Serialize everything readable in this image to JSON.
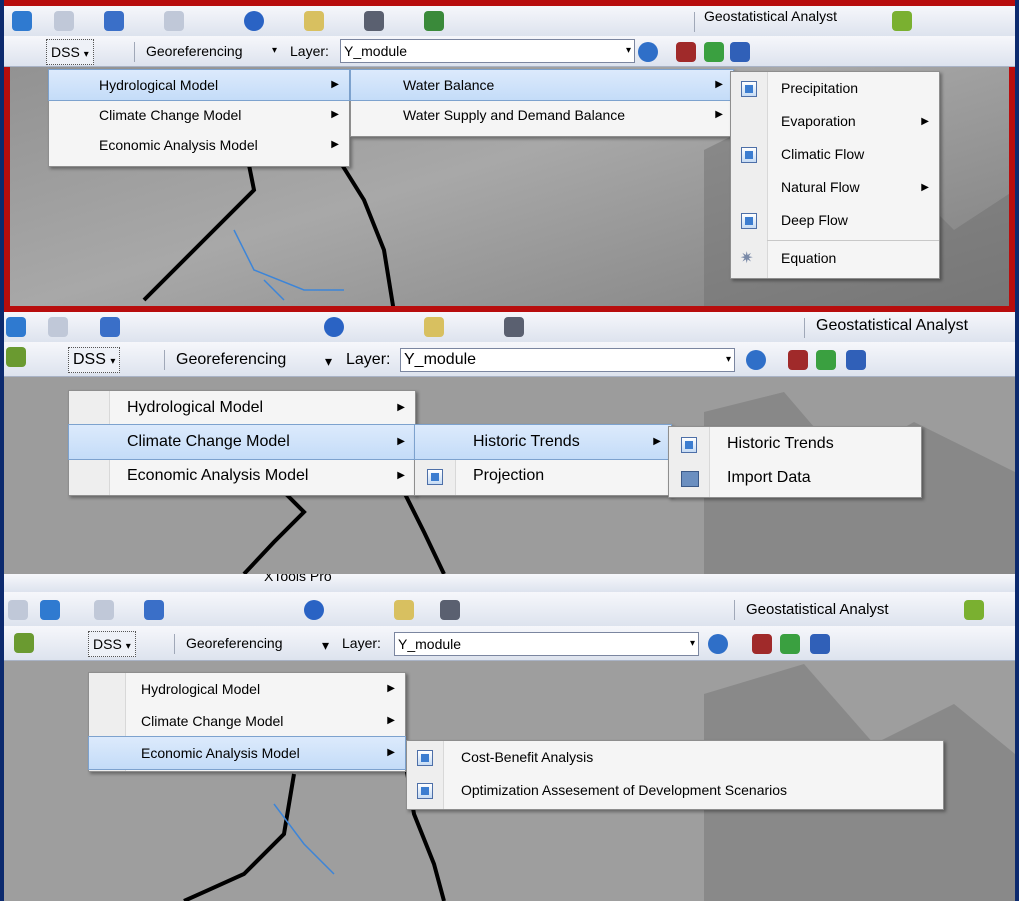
{
  "toolbar": {
    "geostat_label": "Geostatistical Analyst",
    "georef_label": "Georeferencing",
    "layer_label": "Layer:",
    "layer_value": "Y_module",
    "dss_label": "DSS",
    "top_fragment": "XTools Pro"
  },
  "main_menu": {
    "items": [
      {
        "label": "Hydrological Model"
      },
      {
        "label": "Climate Change Model"
      },
      {
        "label": "Economic Analysis Model"
      }
    ]
  },
  "panel1": {
    "sub1": [
      {
        "label": "Water Balance"
      },
      {
        "label": "Water Supply and Demand Balance"
      }
    ],
    "sub2": [
      {
        "label": "Precipitation"
      },
      {
        "label": "Evaporation"
      },
      {
        "label": "Climatic Flow"
      },
      {
        "label": "Natural Flow"
      },
      {
        "label": "Deep Flow"
      },
      {
        "label": "Equation"
      }
    ]
  },
  "panel2": {
    "sub1": [
      {
        "label": "Historic Trends"
      },
      {
        "label": "Projection"
      }
    ],
    "sub2": [
      {
        "label": "Historic Trends"
      },
      {
        "label": "Import Data"
      }
    ]
  },
  "panel3": {
    "sub1": [
      {
        "label": "Cost-Benefit Analysis"
      },
      {
        "label": "Optimization Assesement of Development Scenarios"
      }
    ]
  },
  "colors": {
    "highlight_border": "#b80d0d",
    "menu_highlight": "#c4dcf8",
    "background": "#0c2a6e"
  }
}
